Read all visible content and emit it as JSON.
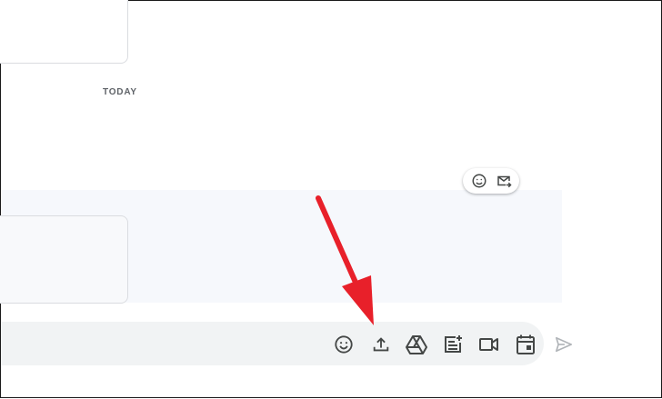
{
  "date_divider": {
    "label": "TODAY"
  },
  "hover_actions": [
    {
      "icon": "emoji-reaction-icon"
    },
    {
      "icon": "forward-to-inbox-icon"
    }
  ],
  "composer": {
    "tools": [
      {
        "icon": "emoji-icon"
      },
      {
        "icon": "upload-file-icon"
      },
      {
        "icon": "google-drive-icon"
      },
      {
        "icon": "post-note-icon"
      },
      {
        "icon": "video-call-icon"
      },
      {
        "icon": "calendar-event-icon"
      }
    ],
    "send": {
      "icon": "send-icon"
    }
  },
  "annotation": {
    "color": "#e8202a",
    "icon": "red-pointer-arrow"
  },
  "colors": {
    "icon": "#444746",
    "send_disabled": "#b0b4b8",
    "composer_bg": "#f1f3f4",
    "hover_bg": "#f6f8fc"
  }
}
